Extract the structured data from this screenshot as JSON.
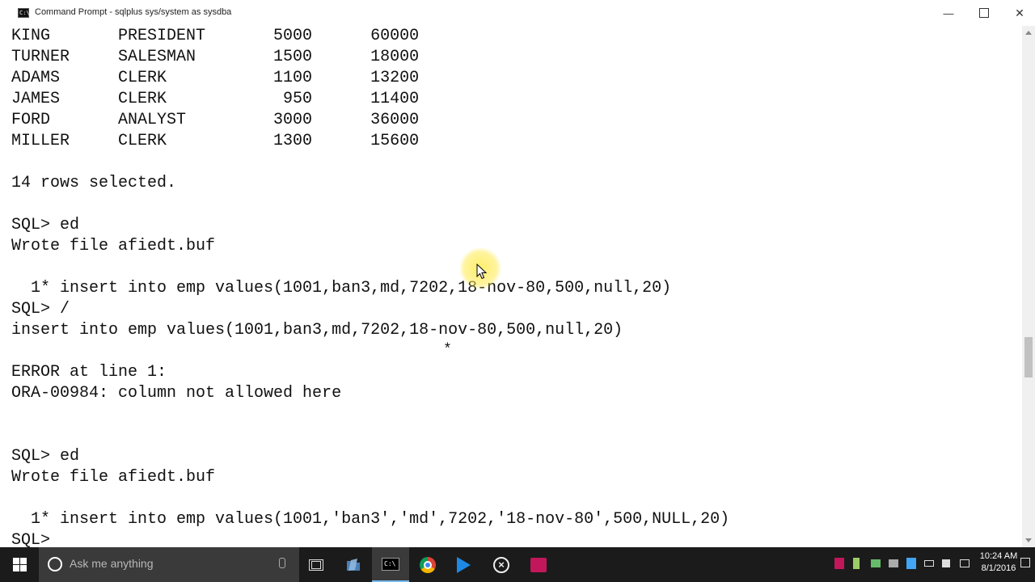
{
  "window": {
    "title": "Command Prompt - sqlplus  sys/system as sysdba",
    "app_icon": "cmd-icon",
    "controls": {
      "minimize": "—",
      "maximize": "",
      "close": "✕"
    }
  },
  "console": {
    "lines": [
      "KING       PRESIDENT       5000      60000",
      "TURNER     SALESMAN        1500      18000",
      "ADAMS      CLERK           1100      13200",
      "JAMES      CLERK            950      11400",
      "FORD       ANALYST         3000      36000",
      "MILLER     CLERK           1300      15600",
      "",
      "14 rows selected.",
      "",
      "SQL> ed",
      "Wrote file afiedt.buf",
      "",
      "  1* insert into emp values(1001,ban3,md,7202,18-nov-80,500,null,20)",
      "SQL> /",
      "insert into emp values(1001,ban3,md,7202,18-nov-80,500,null,20)",
      "",
      "ERROR at line 1:",
      "ORA-00984: column not allowed here",
      "",
      "",
      "SQL> ed",
      "Wrote file afiedt.buf",
      "",
      "  1* insert into emp values(1001,'ban3','md',7202,'18-nov-80',500,NULL,20)",
      "SQL>"
    ],
    "error_marker": "*"
  },
  "taskbar": {
    "search_placeholder": "Ask me anything",
    "icons": [
      "windows-start-icon",
      "search-icon",
      "microphone-icon",
      "task-view-icon",
      "file-explorer-icon",
      "command-prompt-icon",
      "chrome-icon",
      "media-player-icon",
      "xbox-icon",
      "media-app-icon"
    ],
    "tray_icons": [
      "app-tray-icon",
      "app-tray-icon-2",
      "network-adapter-icon",
      "wifi-icon",
      "display-icon",
      "battery-icon",
      "volume-icon",
      "keyboard-icon"
    ],
    "clock_time": "10:24 AM",
    "clock_date": "8/1/2016"
  },
  "colors": {
    "taskbar_bg": "#1b1b1b",
    "search_bg": "#3a3a3a",
    "cursor_highlight": "#ffeb50"
  }
}
